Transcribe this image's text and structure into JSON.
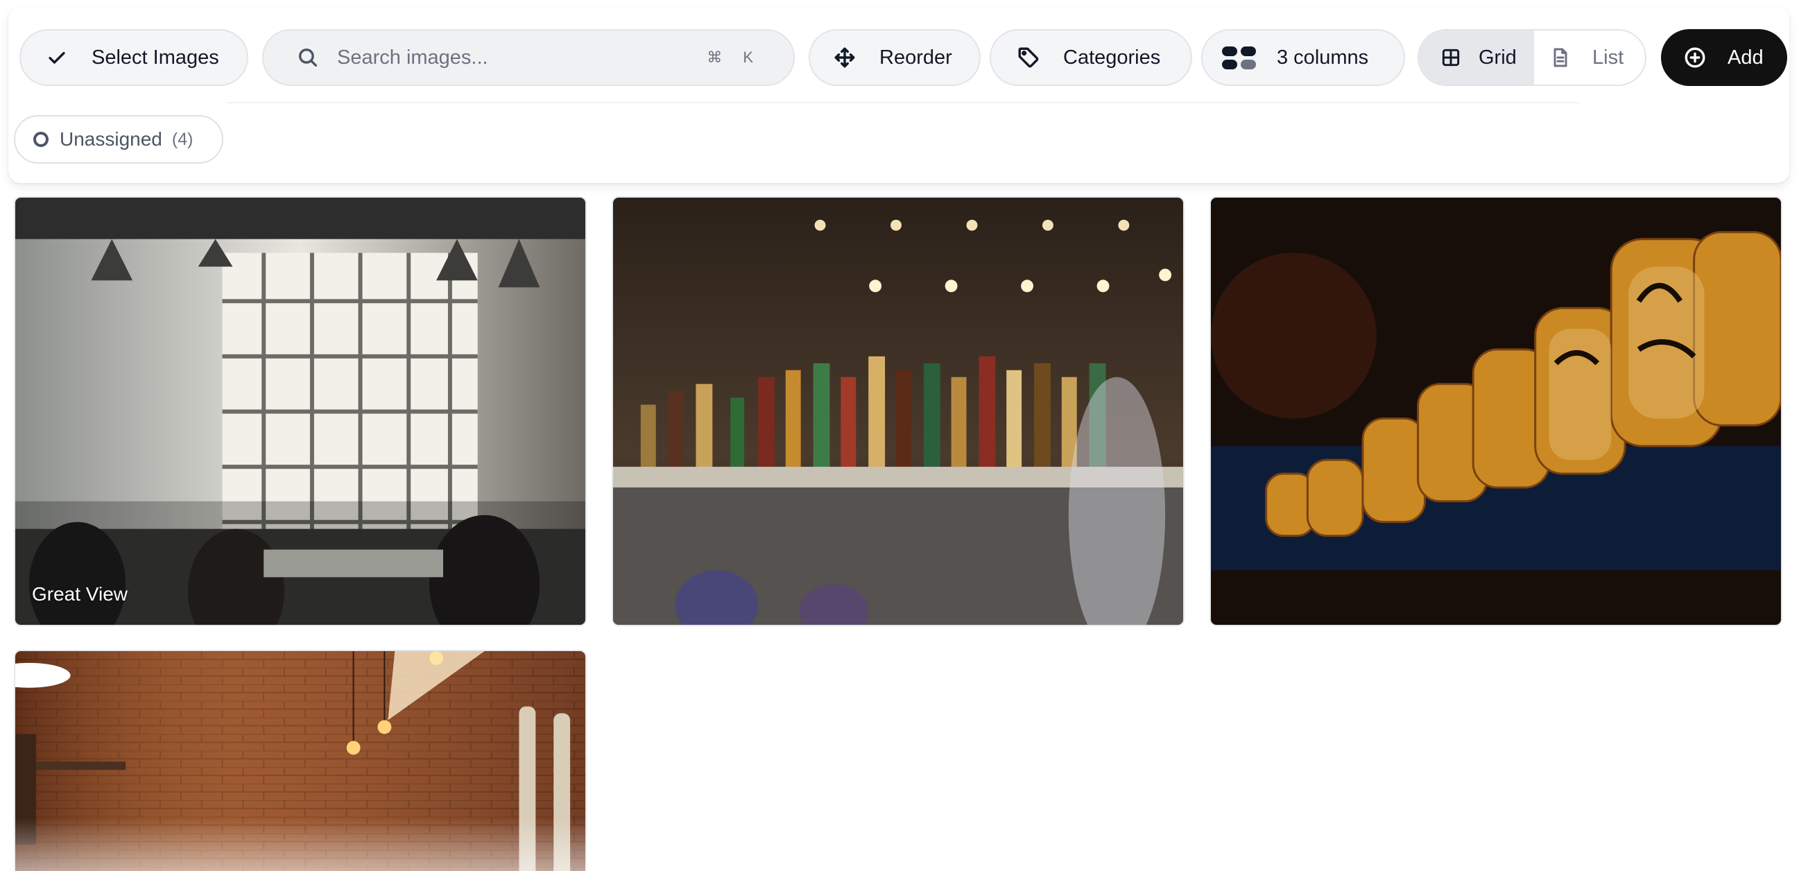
{
  "toolbar": {
    "select_label": "Select Images",
    "search_placeholder": "Search images...",
    "search_shortcut": "⌘ K",
    "reorder_label": "Reorder",
    "categories_label": "Categories",
    "columns_label": "3 columns",
    "view_grid_label": "Grid",
    "view_list_label": "List",
    "active_view": "Grid",
    "add_label": "Add"
  },
  "filters": {
    "chips": [
      {
        "label": "Unassigned",
        "count": "(4)"
      }
    ]
  },
  "gallery": {
    "images": [
      {
        "subject": "cafe-interior-with-windows",
        "caption": "Great View"
      },
      {
        "subject": "bar-shelves-with-bottles",
        "caption": ""
      },
      {
        "subject": "paper-lanterns-at-night",
        "caption": ""
      },
      {
        "subject": "brick-wall-with-hanging-bulbs",
        "caption": ""
      }
    ]
  }
}
